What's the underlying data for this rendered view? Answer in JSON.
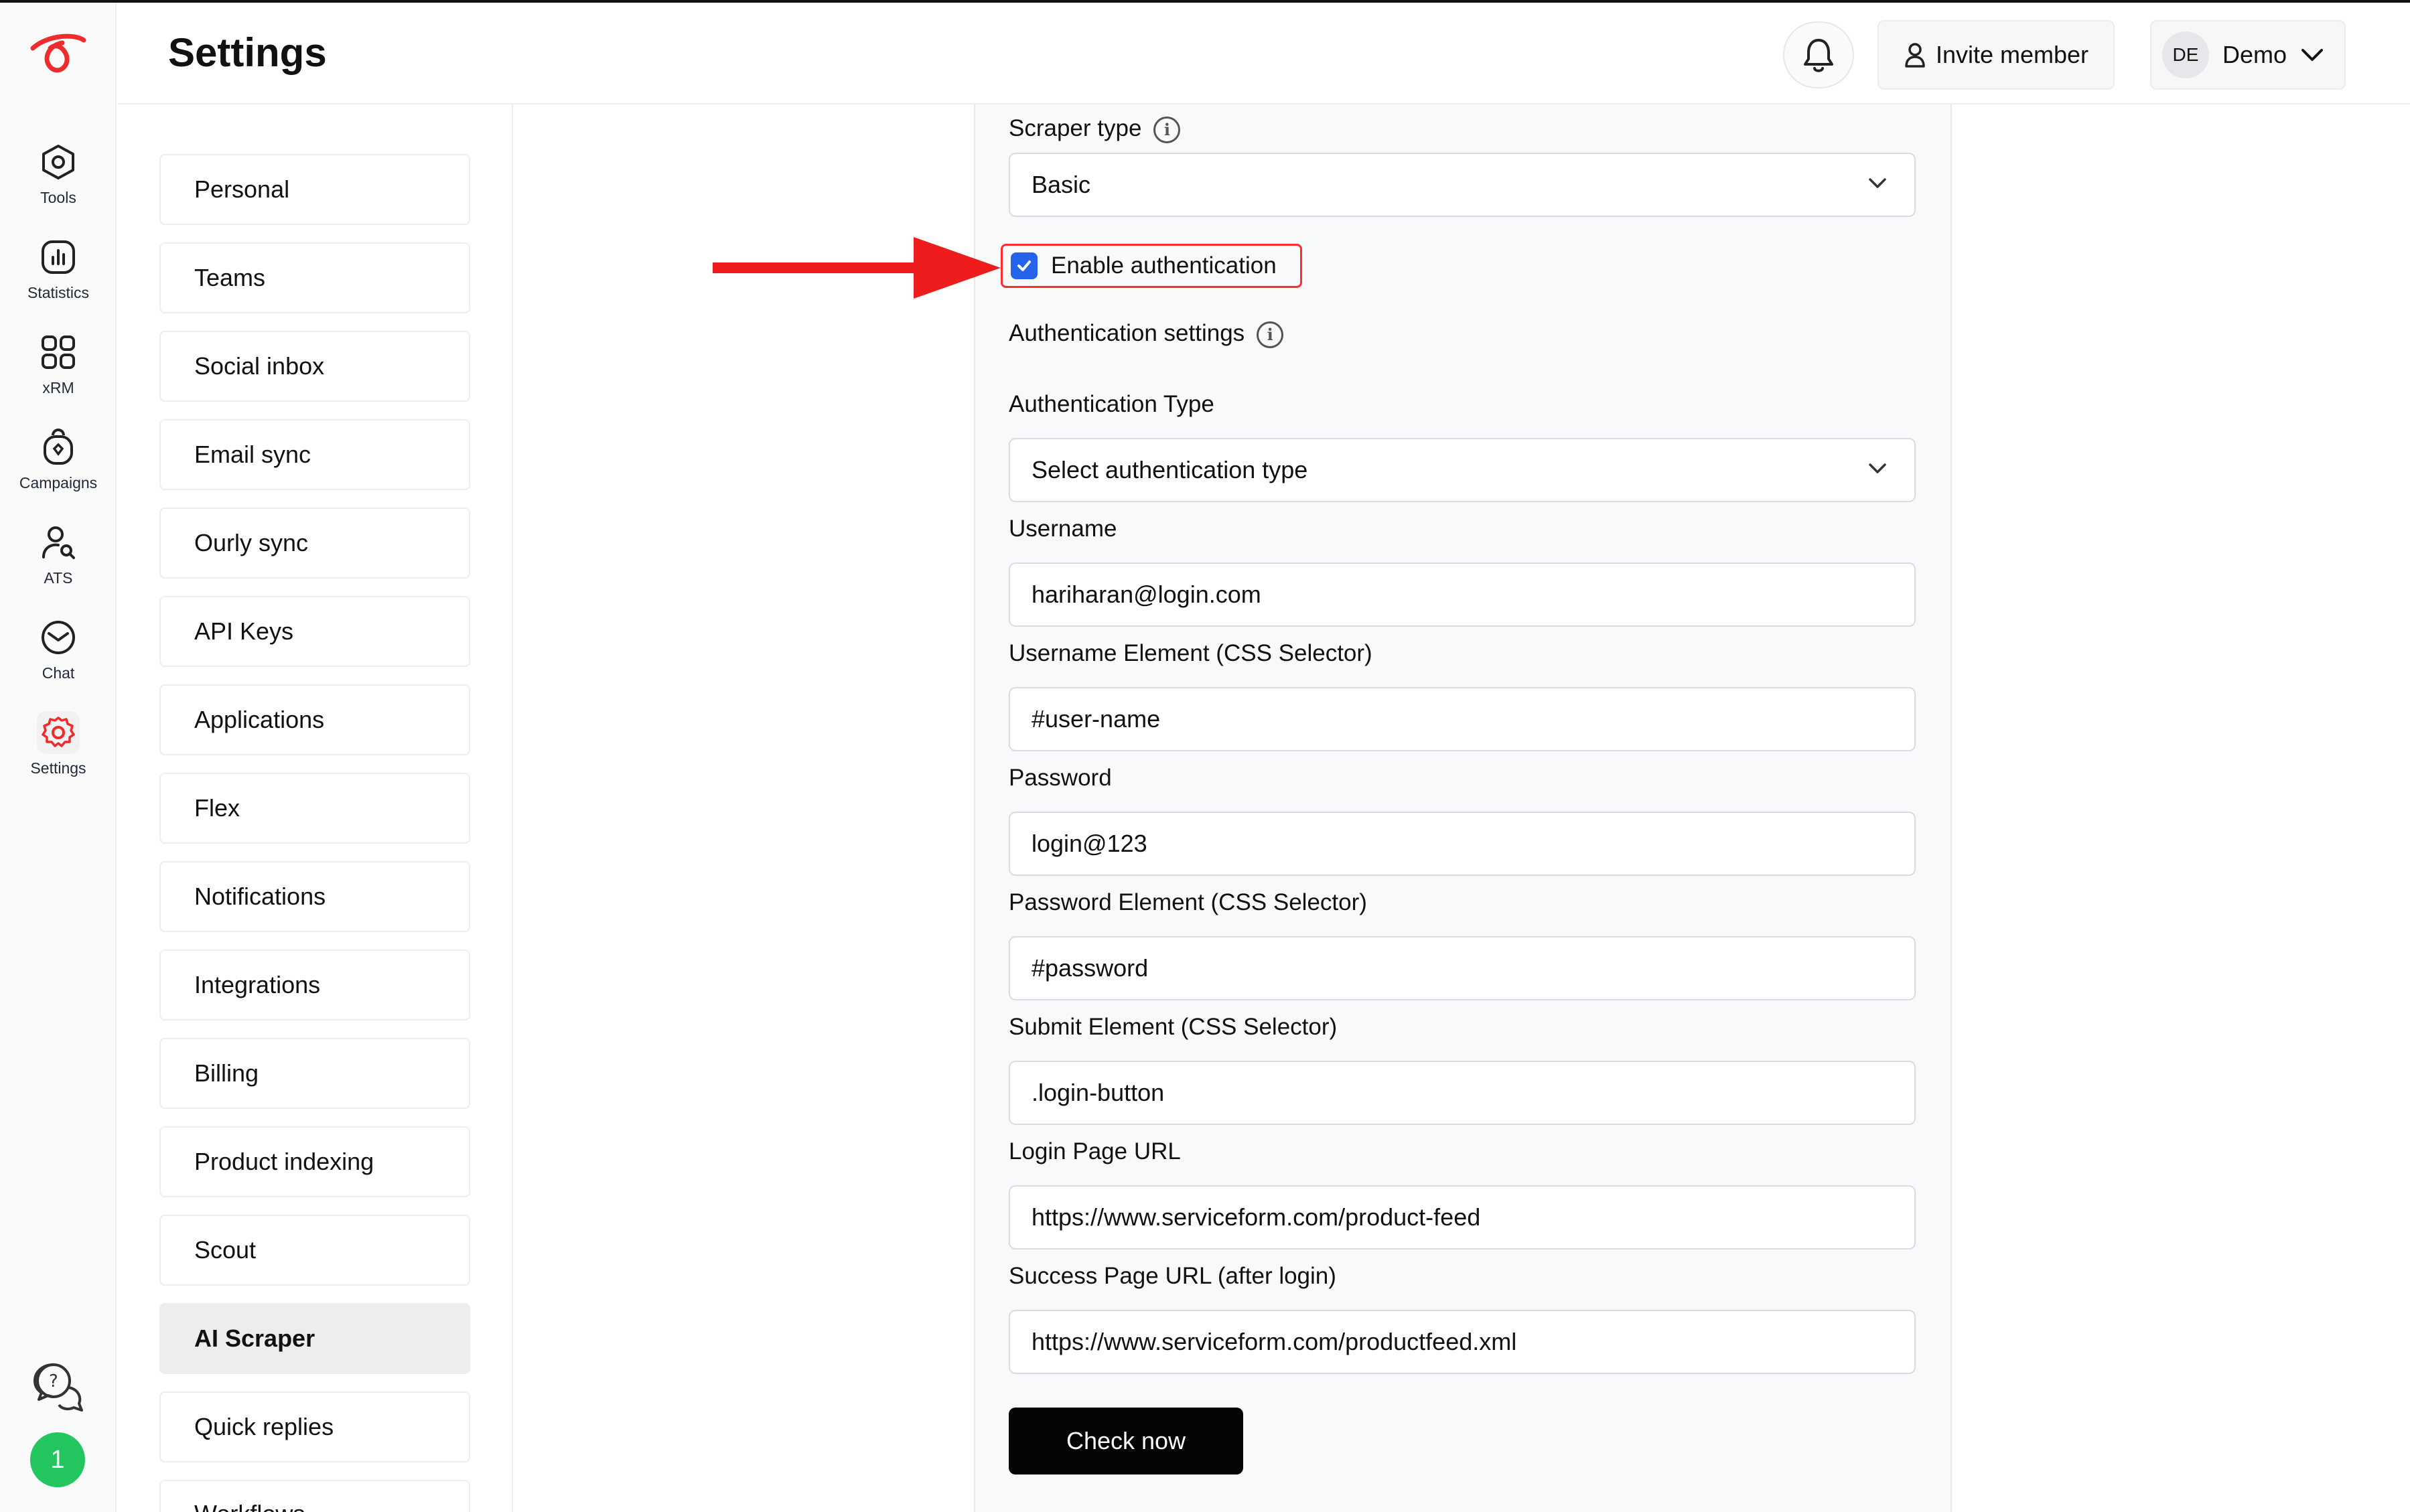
{
  "app": {
    "page_title": "Settings"
  },
  "rail": {
    "items": [
      {
        "label": "Tools",
        "icon": "hexagon-icon"
      },
      {
        "label": "Statistics",
        "icon": "bar-chart-icon"
      },
      {
        "label": "xRM",
        "icon": "grid-icon"
      },
      {
        "label": "Campaigns",
        "icon": "campaign-icon"
      },
      {
        "label": "ATS",
        "icon": "user-search-icon"
      },
      {
        "label": "Chat",
        "icon": "chat-icon"
      },
      {
        "label": "Settings",
        "icon": "gear-icon",
        "active": true
      }
    ],
    "notification_count": "1"
  },
  "header": {
    "invite_label": "Invite member",
    "user_initials": "DE",
    "user_name": "Demo"
  },
  "submenu": {
    "items": [
      "Personal",
      "Teams",
      "Social inbox",
      "Email sync",
      "Ourly sync",
      "API Keys",
      "Applications",
      "Flex",
      "Notifications",
      "Integrations",
      "Billing",
      "Product indexing",
      "Scout",
      "AI Scraper",
      "Quick replies",
      "Workflows"
    ],
    "active": "AI Scraper"
  },
  "form": {
    "scraper_type_label": "Scraper type",
    "scraper_type_value": "Basic",
    "enable_auth_label": "Enable authentication",
    "enable_auth_checked": true,
    "auth_settings_heading": "Authentication settings",
    "auth_type_label": "Authentication Type",
    "auth_type_value": "Select authentication type",
    "username_label": "Username",
    "username_value": "hariharan@login.com",
    "username_element_label": "Username Element (CSS Selector)",
    "username_element_value": "#user-name",
    "password_label": "Password",
    "password_value": "login@123",
    "password_element_label": "Password Element (CSS Selector)",
    "password_element_value": "#password",
    "submit_element_label": "Submit Element (CSS Selector)",
    "submit_element_value": ".login-button",
    "login_url_label": "Login Page URL",
    "login_url_value": "https://www.serviceform.com/product-feed",
    "success_url_label": "Success Page URL (after login)",
    "success_url_value": "https://www.serviceform.com/productfeed.xml",
    "check_button_label": "Check now"
  },
  "colors": {
    "accent_red": "#ef2b2b",
    "checkbox_blue": "#2563eb",
    "badge_green": "#22c55e",
    "primary_button": "#050505"
  }
}
